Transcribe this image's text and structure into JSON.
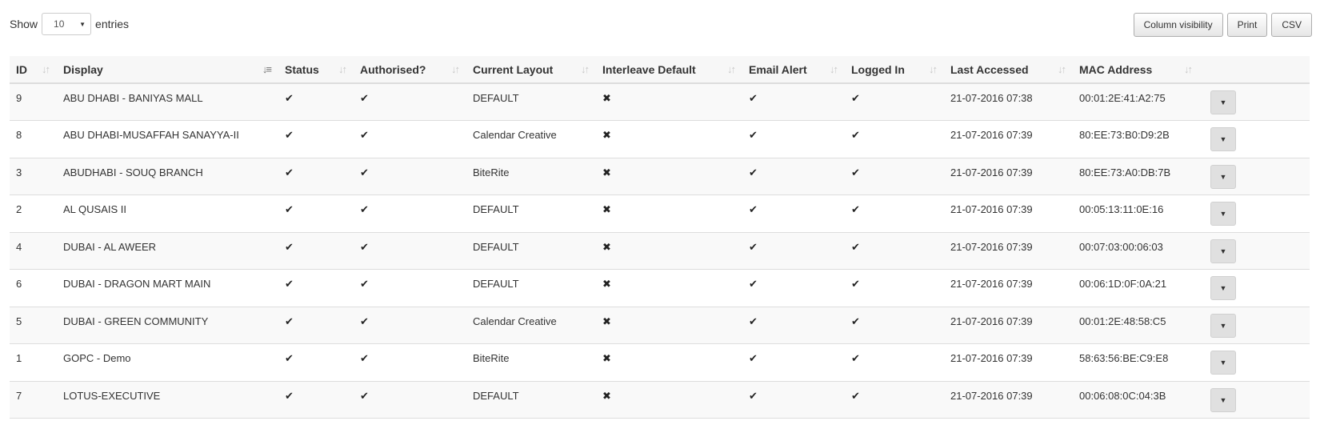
{
  "length": {
    "show_label": "Show",
    "selected": "10",
    "entries_label": "entries"
  },
  "buttons": {
    "column_visibility": "Column visibility",
    "print": "Print",
    "csv": "CSV"
  },
  "icons": {
    "check": "✔",
    "cross": "✖",
    "caret_down": "▼",
    "sort": "↓↑",
    "sort_active": "↓≡"
  },
  "columns": [
    {
      "label": "ID",
      "sort": "sort"
    },
    {
      "label": "Display",
      "sort": "sort_active"
    },
    {
      "label": "Status",
      "sort": "sort"
    },
    {
      "label": "Authorised?",
      "sort": "sort"
    },
    {
      "label": "Current Layout",
      "sort": "sort"
    },
    {
      "label": "Interleave Default",
      "sort": "sort"
    },
    {
      "label": "Email Alert",
      "sort": "sort"
    },
    {
      "label": "Logged In",
      "sort": "sort"
    },
    {
      "label": "Last Accessed",
      "sort": "sort"
    },
    {
      "label": "MAC Address",
      "sort": "sort"
    },
    {
      "label": "",
      "sort": ""
    }
  ],
  "rows": [
    {
      "id": "9",
      "display": "ABU DHABI - BANIYAS MALL",
      "status": true,
      "authorised": true,
      "layout": "DEFAULT",
      "interleave": false,
      "email_alert": true,
      "logged_in": true,
      "last_accessed": "21-07-2016 07:38",
      "mac": "00:01:2E:41:A2:75"
    },
    {
      "id": "8",
      "display": "ABU DHABI-MUSAFFAH SANAYYA-II",
      "status": true,
      "authorised": true,
      "layout": "Calendar Creative",
      "interleave": false,
      "email_alert": true,
      "logged_in": true,
      "last_accessed": "21-07-2016 07:39",
      "mac": "80:EE:73:B0:D9:2B"
    },
    {
      "id": "3",
      "display": "ABUDHABI - SOUQ BRANCH",
      "status": true,
      "authorised": true,
      "layout": "BiteRite",
      "interleave": false,
      "email_alert": true,
      "logged_in": true,
      "last_accessed": "21-07-2016 07:39",
      "mac": "80:EE:73:A0:DB:7B"
    },
    {
      "id": "2",
      "display": "AL QUSAIS II",
      "status": true,
      "authorised": true,
      "layout": "DEFAULT",
      "interleave": false,
      "email_alert": true,
      "logged_in": true,
      "last_accessed": "21-07-2016 07:39",
      "mac": "00:05:13:11:0E:16"
    },
    {
      "id": "4",
      "display": "DUBAI - AL AWEER",
      "status": true,
      "authorised": true,
      "layout": "DEFAULT",
      "interleave": false,
      "email_alert": true,
      "logged_in": true,
      "last_accessed": "21-07-2016 07:39",
      "mac": "00:07:03:00:06:03"
    },
    {
      "id": "6",
      "display": "DUBAI - DRAGON MART MAIN",
      "status": true,
      "authorised": true,
      "layout": "DEFAULT",
      "interleave": false,
      "email_alert": true,
      "logged_in": true,
      "last_accessed": "21-07-2016 07:39",
      "mac": "00:06:1D:0F:0A:21"
    },
    {
      "id": "5",
      "display": "DUBAI - GREEN COMMUNITY",
      "status": true,
      "authorised": true,
      "layout": "Calendar Creative",
      "interleave": false,
      "email_alert": true,
      "logged_in": true,
      "last_accessed": "21-07-2016 07:39",
      "mac": "00:01:2E:48:58:C5"
    },
    {
      "id": "1",
      "display": "GOPC - Demo",
      "status": true,
      "authorised": true,
      "layout": "BiteRite",
      "interleave": false,
      "email_alert": true,
      "logged_in": true,
      "last_accessed": "21-07-2016 07:39",
      "mac": "58:63:56:BE:C9:E8"
    },
    {
      "id": "7",
      "display": "LOTUS-EXECUTIVE",
      "status": true,
      "authorised": true,
      "layout": "DEFAULT",
      "interleave": false,
      "email_alert": true,
      "logged_in": true,
      "last_accessed": "21-07-2016 07:39",
      "mac": "00:06:08:0C:04:3B"
    }
  ]
}
